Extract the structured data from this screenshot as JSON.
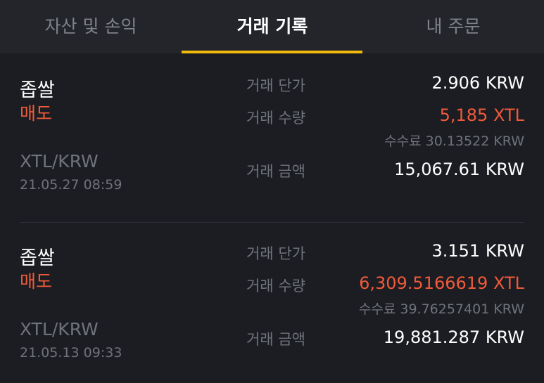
{
  "colors": {
    "accent": "#f0b90b",
    "sell": "#f05a3a",
    "background": "#1c1d22",
    "tabbar": "#23252b"
  },
  "tabs": [
    {
      "label": "자산 및 손익",
      "active": false
    },
    {
      "label": "거래 기록",
      "active": true
    },
    {
      "label": "내 주문",
      "active": false
    }
  ],
  "trades": [
    {
      "coin": "좁쌀",
      "side": "매도",
      "pair": "XTL/KRW",
      "datetime": "21.05.27 08:59",
      "price_label": "거래 단가",
      "price": "2.906 KRW",
      "qty_label": "거래 수량",
      "qty": "5,185 XTL",
      "fee": "수수료 30.13522 KRW",
      "amount_label": "거래 금액",
      "amount": "15,067.61 KRW"
    },
    {
      "coin": "좁쌀",
      "side": "매도",
      "pair": "XTL/KRW",
      "datetime": "21.05.13 09:33",
      "price_label": "거래 단가",
      "price": "3.151 KRW",
      "qty_label": "거래 수량",
      "qty": "6,309.5166619 XTL",
      "fee": "수수료 39.76257401 KRW",
      "amount_label": "거래 금액",
      "amount": "19,881.287 KRW"
    }
  ]
}
